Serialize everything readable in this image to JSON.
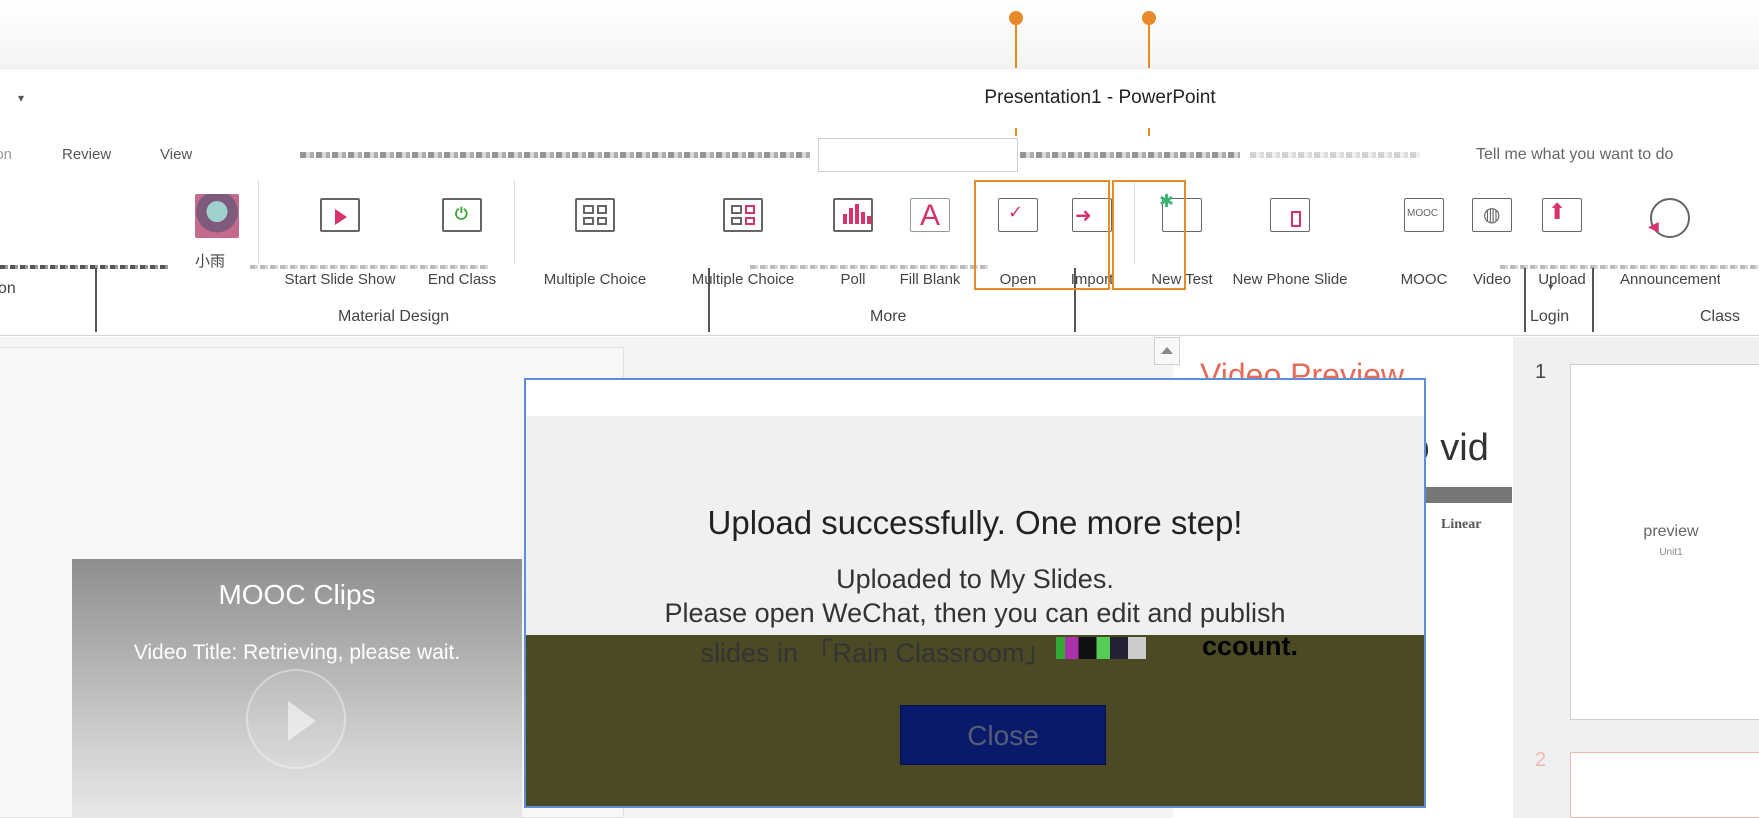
{
  "window": {
    "qat_arrow": "▾",
    "title": "Presentation1  -  PowerPoint"
  },
  "tabs": {
    "items": [
      "ion",
      "Review",
      "View"
    ],
    "tell_me_icon": "lightbulb-icon",
    "tell_me": "Tell me what you want to do"
  },
  "ribbon": {
    "buttons": [
      {
        "label": "小雨",
        "icon": "thumbnail-image-icon"
      },
      {
        "label": "Start Slide Show",
        "icon": "play-slide-icon"
      },
      {
        "label": "End Class",
        "icon": "power-slide-icon"
      },
      {
        "label": "Multiple Choice",
        "icon": "grid-choice-icon"
      },
      {
        "label": "Multiple Choice",
        "icon": "checked-grid-icon"
      },
      {
        "label": "Poll",
        "icon": "bar-chart-icon"
      },
      {
        "label": "Fill Blank",
        "icon": "letter-a-icon"
      },
      {
        "label": "Open",
        "icon": "open-question-icon"
      },
      {
        "label": "Import",
        "icon": "import-icon"
      },
      {
        "label": "New Test",
        "icon": "new-test-icon"
      },
      {
        "label": "New Phone Slide",
        "icon": "phone-slide-icon"
      },
      {
        "label": "MOOC",
        "icon": "mooc-icon"
      },
      {
        "label": "Video",
        "icon": "globe-video-icon"
      },
      {
        "label": "Upload",
        "icon": "upload-icon"
      },
      {
        "label": "Announcement",
        "icon": "announcement-globe-icon"
      }
    ],
    "groups": {
      "left_fragment": "on",
      "material_design": "Material Design",
      "more": "More",
      "login": "Login",
      "class": "Class"
    }
  },
  "work_area": {
    "mooc": {
      "title": "MOOC Clips",
      "subtitle": "Video Title: Retrieving, please wait."
    },
    "preview": {
      "heading": "Video Preview",
      "truncated": "to vid",
      "linear_label": "Linear"
    },
    "thumbnails": [
      {
        "number": "1",
        "preview": "preview",
        "unit": "Unit1"
      },
      {
        "number": "2"
      }
    ]
  },
  "modal": {
    "heading": "Upload successfully. One more step!",
    "line1": "Uploaded to My Slides.",
    "line2": "Please open WeChat, then you can edit and publish",
    "line3": "slides  in 「Rain  Classroom」",
    "line3_end": "ccount.",
    "close_label": "Close"
  },
  "colors": {
    "accent_orange": "#e98a2a",
    "pink": "#d6336c",
    "modal_border": "#5b8fd9",
    "close_button": "#0a1a6a",
    "footer": "#4c4a25",
    "preview_red": "#e56b5a"
  }
}
